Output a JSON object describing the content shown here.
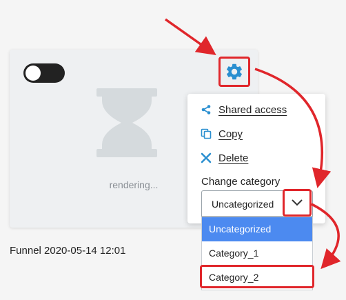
{
  "card": {
    "status_text": "rendering...",
    "caption": "Funnel 2020-05-14 12:01"
  },
  "menu": {
    "items": [
      {
        "label": "Shared access",
        "icon": "share-icon"
      },
      {
        "label": "Copy",
        "icon": "copy-icon"
      },
      {
        "label": "Delete",
        "icon": "delete-icon"
      }
    ],
    "change_category_label": "Change category"
  },
  "category_select": {
    "value": "Uncategorized",
    "options": [
      "Uncategorized",
      "Category_1",
      "Category_2"
    ],
    "highlighted_option": "Category_2"
  },
  "colors": {
    "accent": "#2a8fd0",
    "annotation": "#e0262b",
    "selected_option": "#4c8af0",
    "toggle": "#222222"
  }
}
